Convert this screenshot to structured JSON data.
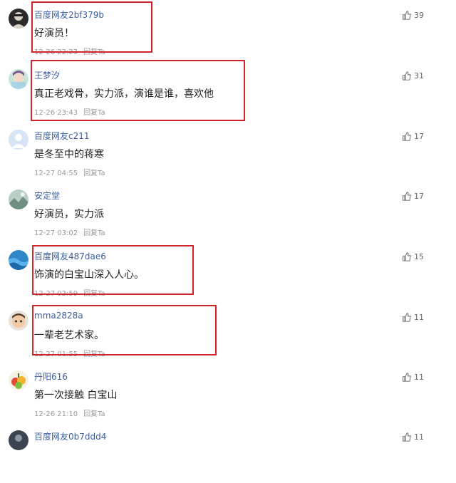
{
  "comments": [
    {
      "username": "百度网友2bf379b",
      "text": "好演员！",
      "time": "12-26 22:23",
      "reply": "回复Ta",
      "likes": "39",
      "avatar_icon": "dark-person-avatar-icon"
    },
    {
      "username": "王梦汐",
      "text": "真正老戏骨，实力派，演谁是谁，喜欢他",
      "time": "12-26 23:43",
      "reply": "回复Ta",
      "likes": "31",
      "avatar_icon": "anime-girl-avatar-icon"
    },
    {
      "username": "百度网友c211",
      "text": "是冬至中的蒋寒",
      "time": "12-27 04:55",
      "reply": "回复Ta",
      "likes": "17",
      "avatar_icon": "default-avatar-icon"
    },
    {
      "username": "安定堂",
      "text": "好演员，实力派",
      "time": "12-27 03:02",
      "reply": "回复Ta",
      "likes": "17",
      "avatar_icon": "landscape-avatar-icon"
    },
    {
      "username": "百度网友487dae6",
      "text": "饰演的白宝山深入人心。",
      "time": "12-27 02:59",
      "reply": "回复Ta",
      "likes": "15",
      "avatar_icon": "blue-wave-avatar-icon"
    },
    {
      "username": "mma2828a",
      "text": "一辈老艺术家。",
      "time": "12-27 01:55",
      "reply": "回复Ta",
      "likes": "11",
      "avatar_icon": "cartoon-face-avatar-icon"
    },
    {
      "username": "丹阳616",
      "text": "第一次接触 白宝山",
      "time": "12-26 21:10",
      "reply": "回复Ta",
      "likes": "11",
      "avatar_icon": "fruit-avatar-icon"
    },
    {
      "username": "百度网友0b7ddd4",
      "text": "",
      "time": "",
      "reply": "",
      "likes": "11",
      "avatar_icon": "dark-avatar-icon"
    }
  ],
  "colors": {
    "highlight_box": "#d5232c",
    "username": "#3b5f9e",
    "meta": "#9a9a9a"
  }
}
